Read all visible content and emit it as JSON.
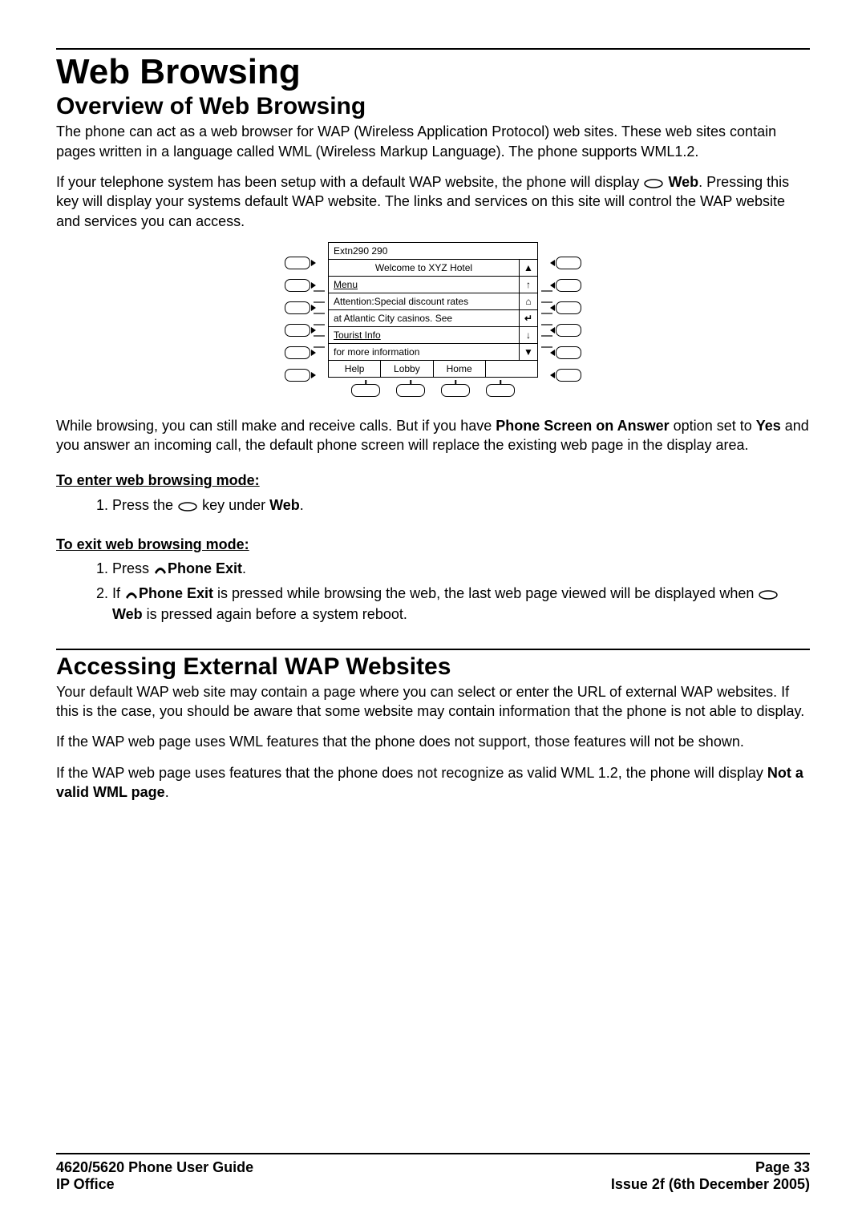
{
  "title": "Web Browsing",
  "section1": {
    "heading": "Overview of Web Browsing",
    "p1": "The phone can act as a web browser for WAP (Wireless Application Protocol) web sites. These web sites contain pages written in a language called WML (Wireless Markup Language). The phone supports WML1.2.",
    "p2a": "If your telephone system has been setup with a default WAP website, the phone will display ",
    "p2_web": "Web",
    "p2b": ". Pressing this key will display your systems default WAP website. The links and services on this site will control the WAP website and services you can access.",
    "p3a": "While browsing, you can still make and receive calls. But if you have ",
    "p3_opt": "Phone Screen on Answer",
    "p3b": " option set to ",
    "p3_yes": "Yes",
    "p3c": " and you answer an incoming call, the default phone screen will replace the existing web page in the display area.",
    "enter_heading": "To enter web browsing mode:",
    "enter_step_a": "Press the ",
    "enter_step_b": " key under ",
    "enter_step_web": "Web",
    "enter_step_c": ".",
    "exit_heading": "To exit web browsing mode:",
    "exit_step1_a": "Press ",
    "exit_step1_b": "Phone Exit",
    "exit_step1_c": ".",
    "exit_step2_a": "If ",
    "exit_step2_b": "Phone Exit",
    "exit_step2_c": " is pressed while browsing the web, the last web page viewed will be displayed when ",
    "exit_step2_web": "Web",
    "exit_step2_d": " is pressed again before a system reboot."
  },
  "diagram": {
    "screen_title": "Extn290 290",
    "welcome": "Welcome to XYZ Hotel",
    "menu": "Menu",
    "line1": "Attention:Special discount rates",
    "line2": "at Atlantic City casinos. See",
    "tourist": "Tourist Info",
    "more": "for more information",
    "sk1": "Help",
    "sk2": "Lobby",
    "sk3": "Home",
    "sb_top": "▲",
    "sb_up": "↑",
    "sb_home": "⌂",
    "sb_back": "↵",
    "sb_down": "↓",
    "sb_bot": "▼"
  },
  "section2": {
    "heading": "Accessing External WAP Websites",
    "p1": "Your default WAP web site may contain a page where you can select or enter the URL of external WAP websites. If this is the case, you should be aware that some website may contain information that the phone is not able to display.",
    "p2": "If the WAP web page uses WML features that the phone does not support, those features will not be shown.",
    "p3a": "If the WAP web page uses features that the phone does not recognize as valid WML 1.2, the phone will display ",
    "p3_bold": "Not a valid WML page",
    "p3b": "."
  },
  "footer": {
    "left1": "4620/5620 Phone User Guide",
    "left2": "IP Office",
    "right1": "Page 33",
    "right2": "Issue 2f (6th December 2005)"
  }
}
